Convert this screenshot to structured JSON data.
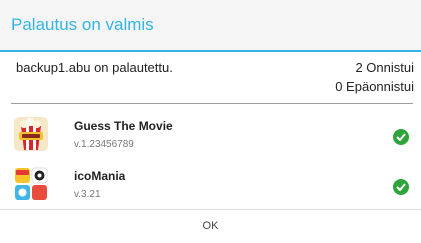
{
  "dialog": {
    "title": "Palautus on valmis",
    "accent_color": "#33b5e5"
  },
  "summary": {
    "file_message": "backup1.abu on palautettu.",
    "success_count": "2 Onnistui",
    "failure_count": "0 Epäonnistui"
  },
  "apps": [
    {
      "name": "Guess The Movie",
      "version": "v.1.23456789",
      "icon": "guess-the-movie-app-icon",
      "status_icon": "success-check-icon",
      "status_color": "#2ea43a"
    },
    {
      "name": "icoMania",
      "version": "v.3.21",
      "icon": "icomania-app-icon",
      "status_icon": "success-check-icon",
      "status_color": "#2ea43a"
    }
  ],
  "buttons": {
    "ok_label": "OK"
  }
}
